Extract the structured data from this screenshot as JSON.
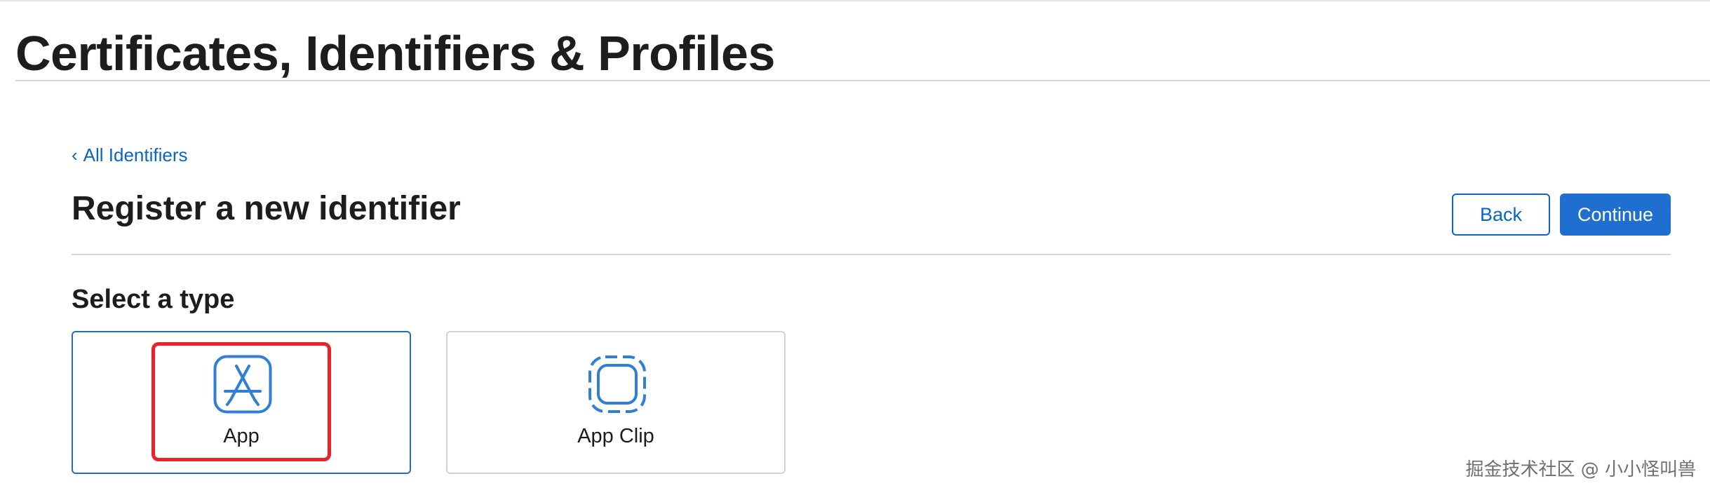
{
  "header": {
    "title": "Certificates, Identifiers & Profiles"
  },
  "navigation": {
    "back_link_label": "All Identifiers",
    "back_link_chevron": "‹"
  },
  "page": {
    "title": "Register a new identifier"
  },
  "actions": {
    "back_label": "Back",
    "continue_label": "Continue"
  },
  "type_selection": {
    "title": "Select a type",
    "options": [
      {
        "label": "App",
        "icon": "app-store-icon",
        "selected": true
      },
      {
        "label": "App Clip",
        "icon": "app-clip-icon",
        "selected": false
      }
    ]
  },
  "annotation": {
    "color": "#e8232a"
  },
  "watermark": {
    "text": "掘金技术社区 @ 小小怪叫兽"
  },
  "colors": {
    "link": "#0a66c2",
    "primary_button": "#1f6fd1",
    "selected_border": "#2a6bb5",
    "icon_blue": "#2f7fd9"
  }
}
